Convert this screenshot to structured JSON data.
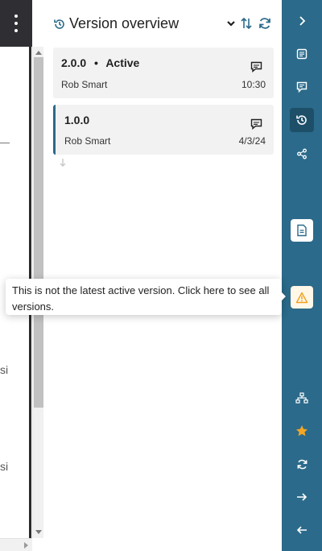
{
  "left_pane": {
    "snippets": [
      "si",
      "si"
    ]
  },
  "panel": {
    "title": "Version overview",
    "versions": [
      {
        "version": "2.0.0",
        "status": "Active",
        "author": "Rob Smart",
        "time": "10:30"
      },
      {
        "version": "1.0.0",
        "status": "",
        "author": "Rob Smart",
        "time": "4/3/24"
      }
    ]
  },
  "tooltip": {
    "text": "This is not the latest active version. Click here to see all versions."
  },
  "sidebar": {
    "icons": [
      "chevron-right-icon",
      "document-icon",
      "comments-icon",
      "history-icon",
      "share-icon",
      "file-card-icon",
      "warning-icon",
      "hierarchy-icon",
      "star-icon",
      "sync-icon",
      "arrow-right-icon",
      "arrow-left-icon"
    ]
  },
  "colors": {
    "sidebar": "#2b6a8a",
    "sidebar_active": "#1d4f69",
    "accent": "#2b6a8a",
    "warning": "#f0a020",
    "star": "#f5a623",
    "topbar": "#2f2f33"
  }
}
